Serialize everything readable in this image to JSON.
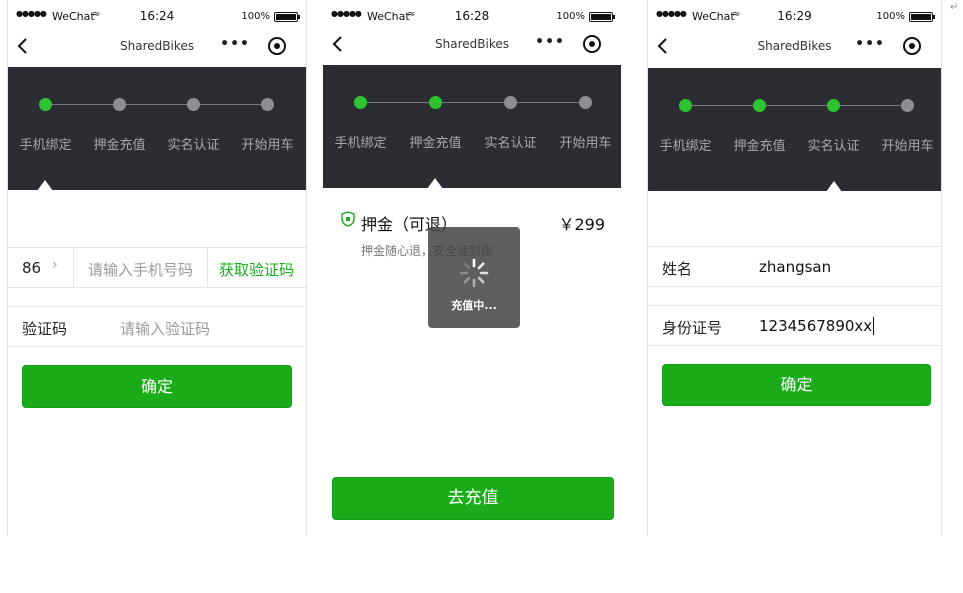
{
  "status_bar": {
    "signal": "●●●●●",
    "carrier": "WeChat",
    "battery": "100%"
  },
  "nav": {
    "title": "SharedBikes",
    "more": "•••"
  },
  "steps": [
    "手机绑定",
    "押金充值",
    "实名认证",
    "开始用车"
  ],
  "colors": {
    "accent_green": "#1aad19",
    "step_active": "#2dc430",
    "header_dark": "#2b2d33"
  },
  "screen1": {
    "time": "16:24",
    "active_steps": 1,
    "country_code": "86",
    "phone_placeholder": "请输入手机号码",
    "get_code": "获取验证码",
    "code_label": "验证码",
    "code_placeholder": "请输入验证码",
    "confirm": "确定"
  },
  "screen2": {
    "time": "16:28",
    "active_steps": 2,
    "deposit_title": "押金（可退）",
    "deposit_amount": "￥299",
    "deposit_note": "押金随心退，安全速到账",
    "toast": "充值中...",
    "charge_button": "去充值"
  },
  "screen3": {
    "time": "16:29",
    "active_steps": 3,
    "name_label": "姓名",
    "name_value": "zhangsan",
    "id_label": "身份证号",
    "id_value": "1234567890xx",
    "confirm": "确定"
  }
}
